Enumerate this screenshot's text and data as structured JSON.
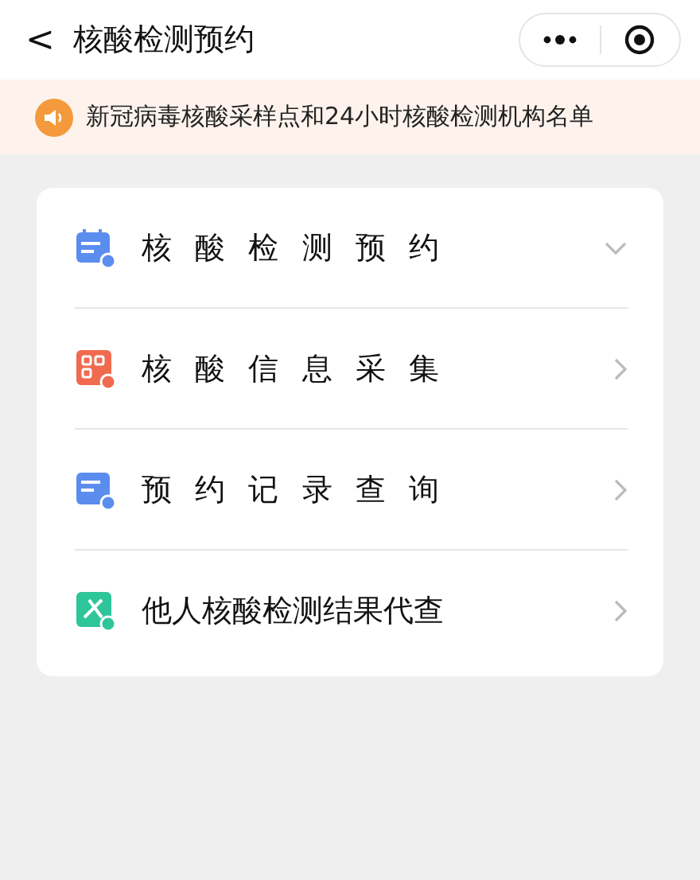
{
  "header": {
    "back": "<",
    "title": "核酸检测预约"
  },
  "notice": {
    "text": "新冠病毒核酸采样点和24小时核酸检测机构名单"
  },
  "menu": [
    {
      "label": "核 酸 检 测 预 约",
      "color": "#5b8def",
      "kind": "dropdown"
    },
    {
      "label": "核 酸 信 息 采 集",
      "color": "#f06a4f",
      "kind": "link"
    },
    {
      "label": "预 约 记 录 查 询",
      "color": "#5b8def",
      "kind": "link"
    },
    {
      "label": "他人核酸检测结果代查",
      "color": "#2fc59a",
      "kind": "link"
    }
  ]
}
